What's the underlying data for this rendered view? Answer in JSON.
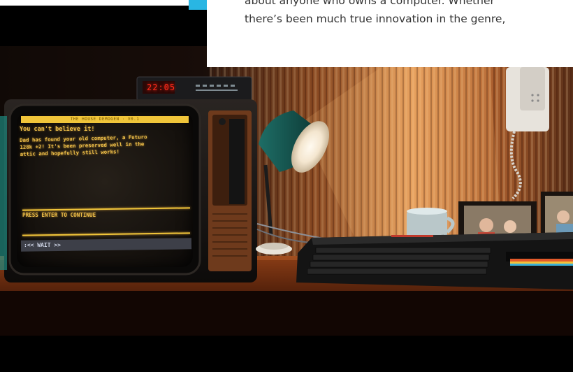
{
  "article": {
    "line1": "about anyone who owns a computer. Whether",
    "line2": "there’s been much true innovation in the genre,"
  },
  "screen": {
    "title_bar": "THE HOUSE DEMOGEN  ·  V0.1",
    "headline": "You can't believe it!",
    "message": "Dad has found your old computer, a Futuro\n128k +2! It's been preserved well in the\nattic and hopefully still works!",
    "prompt": "PRESS ENTER TO CONTINUE",
    "wait": ":<< WAIT >>"
  },
  "clock": {
    "time": "22:05"
  },
  "colors": {
    "screen_text": "#f2c24a",
    "accent": "#29b6e3",
    "clock": "#ff2a1a"
  }
}
